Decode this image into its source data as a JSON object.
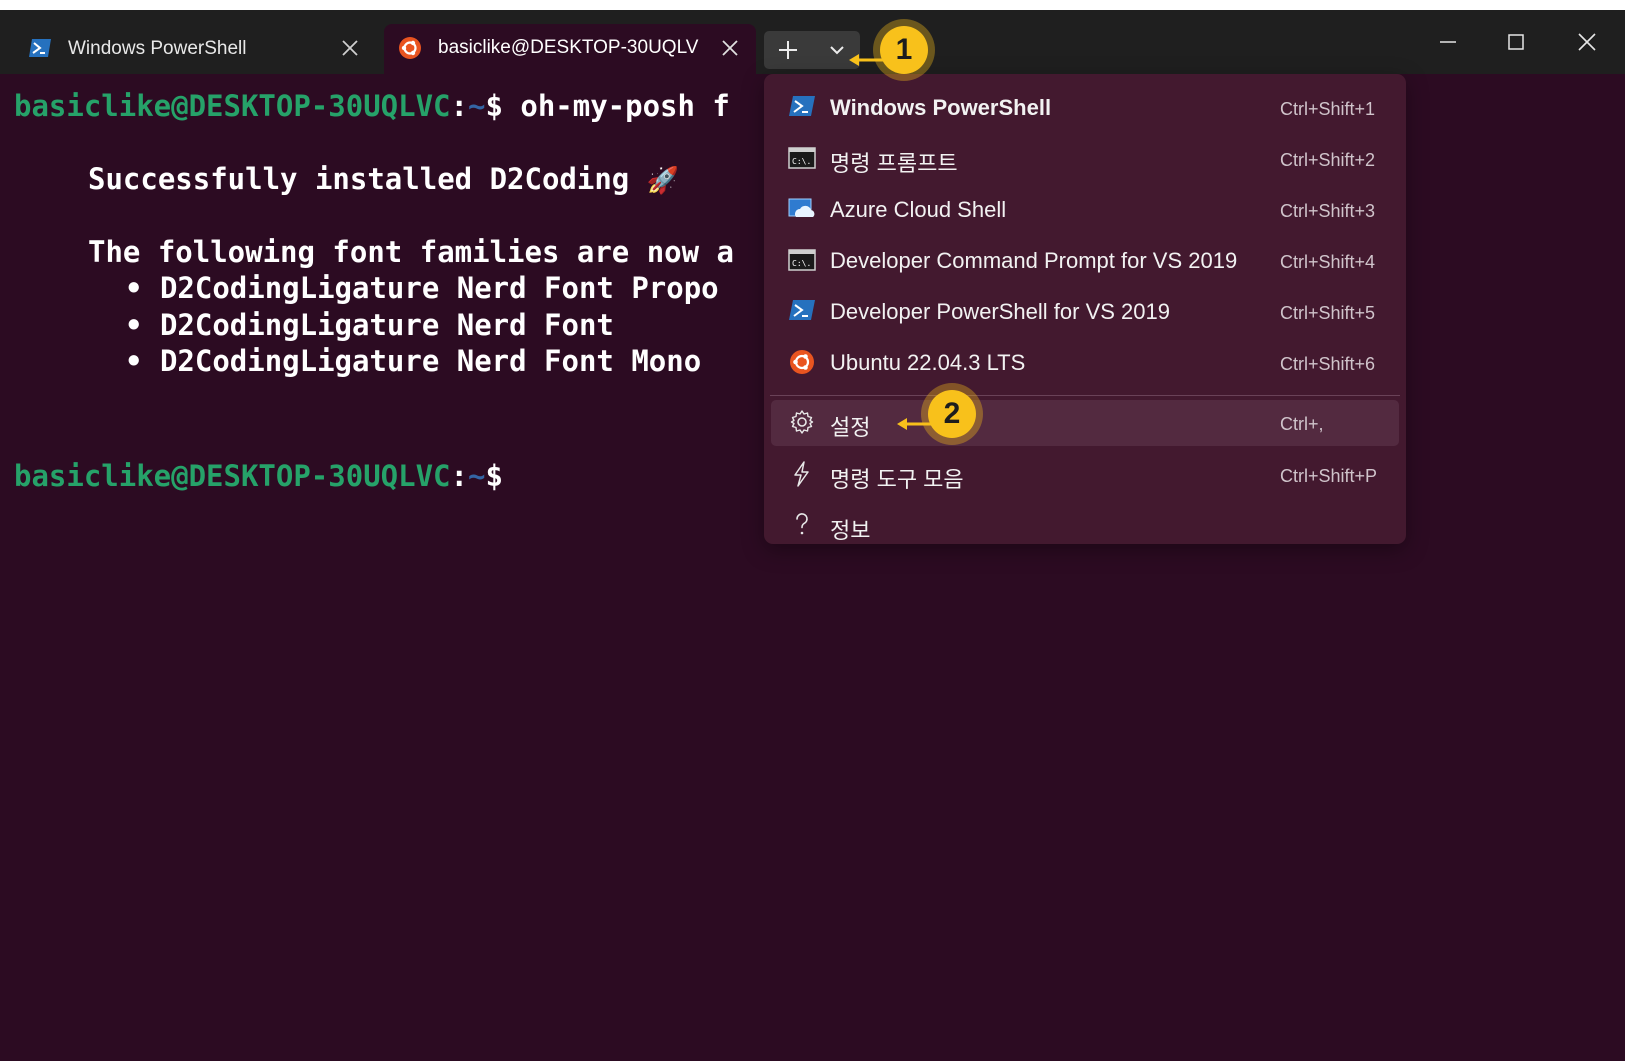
{
  "tabs": [
    {
      "label": "Windows PowerShell",
      "icon": "powershell-icon"
    },
    {
      "label": "basiclike@DESKTOP-30UQLV",
      "icon": "ubuntu-icon"
    }
  ],
  "terminal": {
    "prompt_user": "basiclike@DESKTOP-30UQLVC",
    "prompt_colon": ":",
    "prompt_tilde": "~",
    "prompt_dollar": "$",
    "command": " oh-my-posh f",
    "success_text": "Successfully installed D2Coding",
    "rocket": "🚀",
    "families_text": "The following font families are now a",
    "families": [
      "D2CodingLigature Nerd Font Propo",
      "D2CodingLigature Nerd Font",
      "D2CodingLigature Nerd Font Mono"
    ],
    "bullet": "•"
  },
  "menu": {
    "items": [
      {
        "label": "Windows PowerShell",
        "shortcut": "Ctrl+Shift+1",
        "icon": "powershell-icon"
      },
      {
        "label": "명령 프롬프트",
        "shortcut": "Ctrl+Shift+2",
        "icon": "cmd-icon"
      },
      {
        "label": "Azure Cloud Shell",
        "shortcut": "Ctrl+Shift+3",
        "icon": "azure-cloud-icon"
      },
      {
        "label": "Developer Command Prompt for VS 2019",
        "shortcut": "Ctrl+Shift+4",
        "icon": "cmd-icon"
      },
      {
        "label": "Developer PowerShell for VS 2019",
        "shortcut": "Ctrl+Shift+5",
        "icon": "powershell-icon"
      },
      {
        "label": "Ubuntu 22.04.3 LTS",
        "shortcut": "Ctrl+Shift+6",
        "icon": "ubuntu-icon"
      },
      {
        "label": "설정",
        "shortcut": "Ctrl+,",
        "icon": "gear-icon"
      },
      {
        "label": "명령 도구 모음",
        "shortcut": "Ctrl+Shift+P",
        "icon": "lightning-icon"
      },
      {
        "label": "정보",
        "shortcut": "",
        "icon": "question-icon"
      }
    ]
  },
  "callouts": {
    "first": "1",
    "second": "2"
  },
  "colors": {
    "terminal_bg": "#2c0b22",
    "titlebar_bg": "#1f1f1f",
    "menu_bg": "#43192f",
    "prompt_green": "#26a269",
    "prompt_blue": "#3465a4",
    "callout": "#f8c11b"
  }
}
